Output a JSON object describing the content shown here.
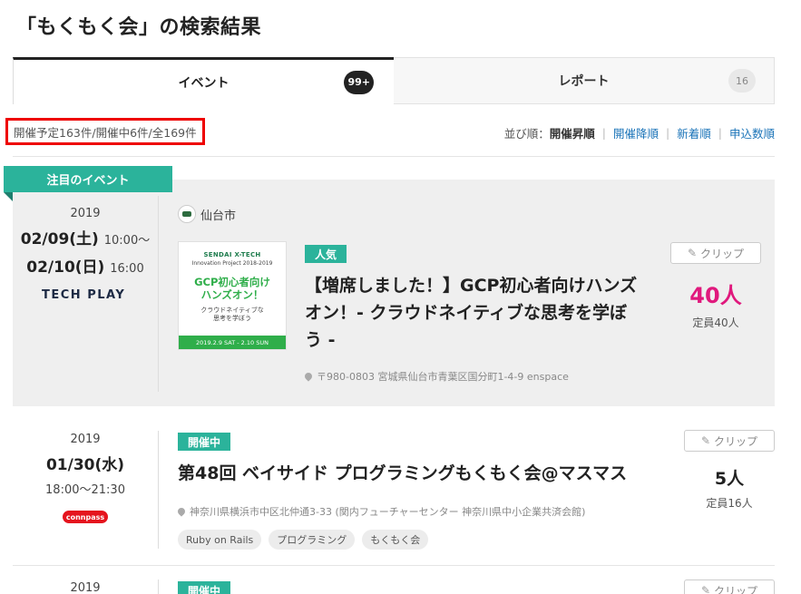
{
  "page": {
    "title": "「もくもく会」の検索結果"
  },
  "tabs": [
    {
      "label": "イベント",
      "count": "99+",
      "active": true
    },
    {
      "label": "レポート",
      "count": "16",
      "active": false
    }
  ],
  "results": {
    "count_text": "開催予定163件/開催中6件/全169件",
    "sort_label": "並び順：",
    "sort_current": "開催昇順",
    "sort_options": [
      "開催降順",
      "新着順",
      "申込数順"
    ]
  },
  "featured": {
    "label": "注目のイベント"
  },
  "events": [
    {
      "year": "2019",
      "date1": "02/09(土)",
      "time1": "10:00〜",
      "date2": "02/10(日)",
      "time2": "16:00",
      "platform": "TECH PLAY",
      "organizer": "仙台市",
      "badge": "人気",
      "title_line1": "【増席しました！】GCP初心者向けハンズ",
      "title_line2": "オン！- クラウドネイティブな思考を学ぼ",
      "title_line3": "う -",
      "address": "〒980-0803 宮城県仙台市青葉区国分町1-4-9 enspace",
      "clip": "クリップ",
      "capacity": "40人",
      "capacity_label": "定員40人",
      "thumb": {
        "line1": "SENDAI X-TECH",
        "line2": "Innovation Project 2018-2019",
        "line3": "GCP初心者向け",
        "line4": "ハンズオン！",
        "line5": "クラウドネイティブな",
        "line6": "思考を学ぼう",
        "line7": "2019.2.9 SAT - 2.10 SUN"
      }
    },
    {
      "year": "2019",
      "date1": "01/30(水)",
      "time1": "18:00〜21:30",
      "platform": "connpass",
      "badge": "開催中",
      "title_line1": "第48回 ベイサイド プログラミングもくもく会@マスマス",
      "address": "神奈川県横浜市中区北仲通3-33 (関内フューチャーセンター 神奈川県中小企業共済会館)",
      "clip": "クリップ",
      "capacity": "5人",
      "capacity_label": "定員16人",
      "tags": [
        "Ruby on Rails",
        "プログラミング",
        "もくもく会"
      ]
    },
    {
      "year": "2019",
      "badge": "開催中",
      "clip": "クリップ"
    }
  ],
  "colors": {
    "accent_green": "#2bb39b",
    "highlight_pink": "#e0197d",
    "link_blue": "#1a73b8",
    "connpass_red": "#e5141e"
  }
}
